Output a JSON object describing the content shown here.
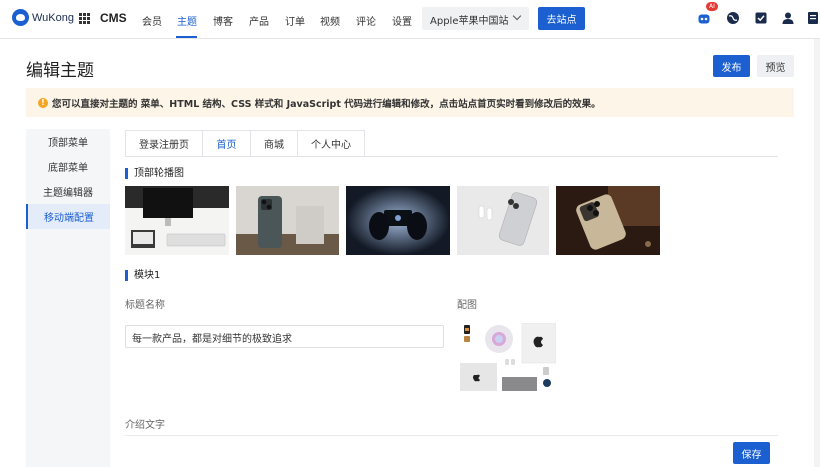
{
  "app": {
    "brand": "WuKong",
    "name": "CMS"
  },
  "nav": {
    "items": [
      "会员",
      "主题",
      "博客",
      "产品",
      "订单",
      "视频",
      "评论",
      "设置"
    ],
    "active": "主题",
    "site_select": "Apple苹果中国站",
    "goto_label": "去站点",
    "ai_badge": "AI",
    "icons": [
      "robot-icon",
      "globe-icon",
      "checkbox-icon",
      "user-icon",
      "document-icon"
    ]
  },
  "page": {
    "title": "编辑主题",
    "publish_label": "发布",
    "preview_label": "预览",
    "notice": "您可以直接对主题的 菜单、HTML 结构、CSS 样式和 JavaScript 代码进行编辑和修改，点击站点首页实时看到修改后的效果。"
  },
  "sidebar": {
    "items": [
      "顶部菜单",
      "底部菜单",
      "主题编辑器",
      "移动端配置"
    ],
    "active": "移动端配置"
  },
  "tabs": {
    "items": [
      "登录注册页",
      "首页",
      "商城",
      "个人中心"
    ],
    "active": "首页"
  },
  "carousel": {
    "title": "顶部轮播图",
    "images": [
      "desktop-imac-photo",
      "iphone-back-photo",
      "hands-holding-phone-photo",
      "airpods-iphone-photo",
      "iphone-leather-photo"
    ]
  },
  "module": {
    "title": "模块1",
    "title_label": "标题名称",
    "title_value": "每一款产品，都是对细节的极致追求",
    "image_label": "配图",
    "intro_label": "介绍文字",
    "save_label": "保存"
  },
  "colors": {
    "accent": "#1b5fd0",
    "notice_bg": "#fdf6e8",
    "warn": "#f5a623"
  }
}
